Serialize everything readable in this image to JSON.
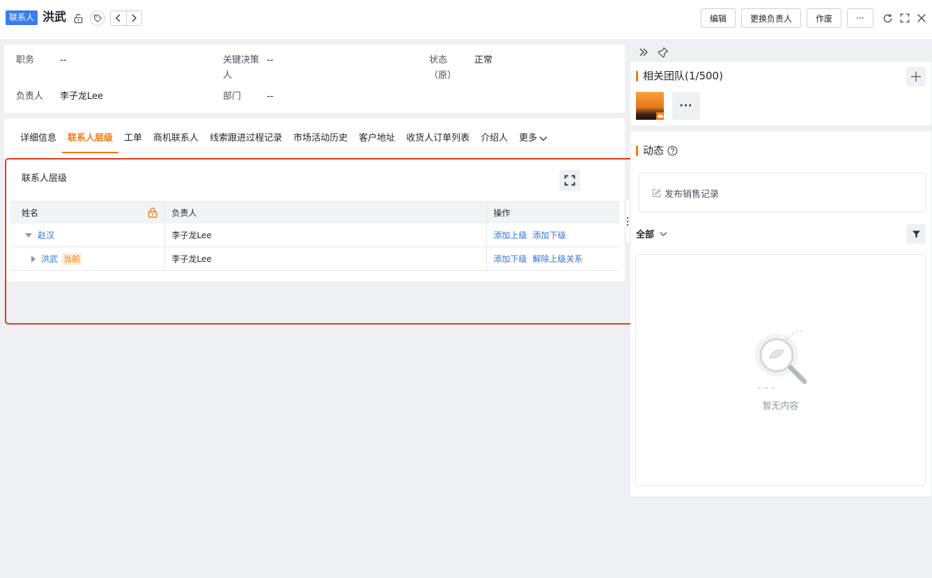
{
  "header": {
    "type_badge": "联系人",
    "title": "洪武",
    "buttons": {
      "edit": "编辑",
      "change_owner": "更换负责人",
      "void": "作废",
      "more": "···"
    }
  },
  "summary": {
    "fields": [
      {
        "label": "职务",
        "value": "--"
      },
      {
        "label": "关键决策人",
        "value": "--"
      },
      {
        "label": "状态（原）",
        "value": "正常"
      },
      {
        "label": "负责人",
        "value": "李子龙Lee"
      },
      {
        "label": "部门",
        "value": "--"
      }
    ]
  },
  "tabs": {
    "items": [
      "详细信息",
      "联系人层级",
      "工单",
      "商机联系人",
      "线索跟进过程记录",
      "市场活动历史",
      "客户地址",
      "收货人订单列表",
      "介绍人"
    ],
    "more_label": "更多",
    "active_index": 1
  },
  "hierarchy": {
    "title": "联系人层级",
    "columns": {
      "name": "姓名",
      "owner": "负责人",
      "actions": "操作"
    },
    "rows": [
      {
        "name": "赵汉",
        "owner": "李子龙Lee",
        "action1": "添加上级",
        "action2": "添加下级"
      },
      {
        "name": "洪武",
        "current_tag": "当前",
        "owner": "李子龙Lee",
        "action1": "添加下级",
        "action2": "解除上级关系"
      }
    ]
  },
  "team": {
    "title": "相关团队(1/500)",
    "more_label": "···"
  },
  "activity": {
    "title": "动态",
    "publish_placeholder": "发布销售记录",
    "filter_label": "全部",
    "empty_text": "暂无内容"
  },
  "colors": {
    "accent": "#f07a12",
    "link": "#2e70e6",
    "badge": "#3a7cf0",
    "highlight": "#e8341c"
  }
}
